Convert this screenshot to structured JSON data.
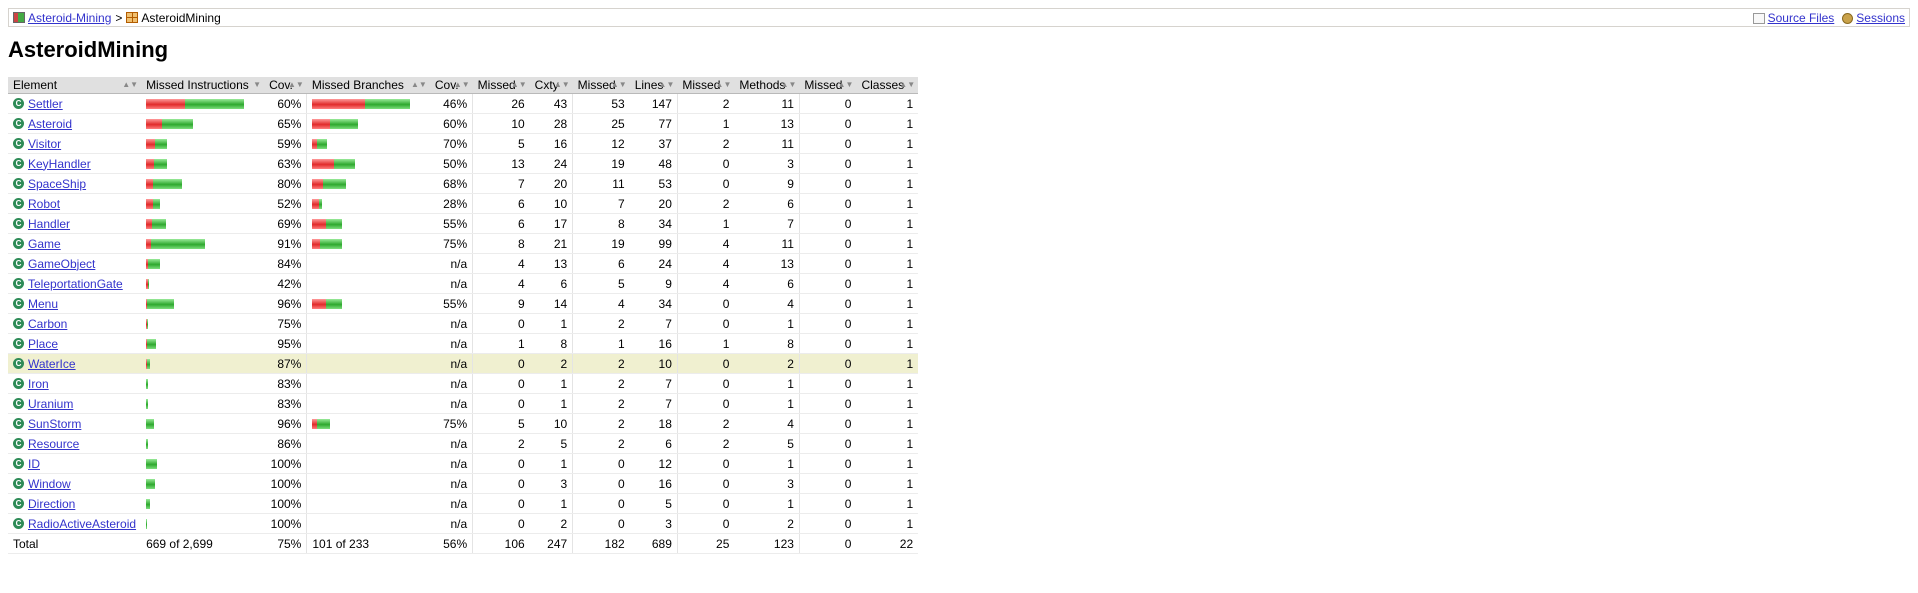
{
  "breadcrumb": {
    "report_link": "Asteroid-Mining",
    "separator": ">",
    "current": "AsteroidMining",
    "report_icon": "report-icon",
    "package_icon": "package-icon"
  },
  "info": {
    "source_files": "Source Files",
    "sessions": "Sessions",
    "source_icon": "source-file-icon",
    "sessions_icon": "sessions-icon"
  },
  "page_title": "AsteroidMining",
  "headers": {
    "element": "Element",
    "missed_instructions": "Missed Instructions",
    "cov1": "Cov.",
    "missed_branches": "Missed Branches",
    "cov2": "Cov.",
    "missed_cxty": "Missed",
    "cxty": "Cxty",
    "missed_lines": "Missed",
    "lines": "Lines",
    "missed_methods": "Missed",
    "methods": "Methods",
    "missed_classes": "Missed",
    "classes": "Classes"
  },
  "class_icon_glyph": "C",
  "rows": [
    {
      "name": "Settler",
      "instr_missed_frac": 0.4,
      "instr_total_rel": 1.0,
      "instr_cov": "60%",
      "br_missed_frac": 0.54,
      "br_total_rel": 1.0,
      "br_cov": "46%",
      "mc": "26",
      "c": "43",
      "ml": "53",
      "l": "147",
      "mm": "2",
      "m": "11",
      "mcl": "0",
      "cl": "1"
    },
    {
      "name": "Asteroid",
      "instr_missed_frac": 0.35,
      "instr_total_rel": 0.48,
      "instr_cov": "65%",
      "br_missed_frac": 0.4,
      "br_total_rel": 0.47,
      "br_cov": "60%",
      "mc": "10",
      "c": "28",
      "ml": "25",
      "l": "77",
      "mm": "1",
      "m": "13",
      "mcl": "0",
      "cl": "1"
    },
    {
      "name": "Visitor",
      "instr_missed_frac": 0.41,
      "instr_total_rel": 0.21,
      "instr_cov": "59%",
      "br_missed_frac": 0.3,
      "br_total_rel": 0.15,
      "br_cov": "70%",
      "mc": "5",
      "c": "16",
      "ml": "12",
      "l": "37",
      "mm": "2",
      "m": "11",
      "mcl": "0",
      "cl": "1"
    },
    {
      "name": "KeyHandler",
      "instr_missed_frac": 0.37,
      "instr_total_rel": 0.21,
      "instr_cov": "63%",
      "br_missed_frac": 0.5,
      "br_total_rel": 0.44,
      "br_cov": "50%",
      "mc": "13",
      "c": "24",
      "ml": "19",
      "l": "48",
      "mm": "0",
      "m": "3",
      "mcl": "0",
      "cl": "1"
    },
    {
      "name": "SpaceShip",
      "instr_missed_frac": 0.2,
      "instr_total_rel": 0.37,
      "instr_cov": "80%",
      "br_missed_frac": 0.32,
      "br_total_rel": 0.35,
      "br_cov": "68%",
      "mc": "7",
      "c": "20",
      "ml": "11",
      "l": "53",
      "mm": "0",
      "m": "9",
      "mcl": "0",
      "cl": "1"
    },
    {
      "name": "Robot",
      "instr_missed_frac": 0.48,
      "instr_total_rel": 0.14,
      "instr_cov": "52%",
      "br_missed_frac": 0.72,
      "br_total_rel": 0.1,
      "br_cov": "28%",
      "mc": "6",
      "c": "10",
      "ml": "7",
      "l": "20",
      "mm": "2",
      "m": "6",
      "mcl": "0",
      "cl": "1"
    },
    {
      "name": "Handler",
      "instr_missed_frac": 0.31,
      "instr_total_rel": 0.2,
      "instr_cov": "69%",
      "br_missed_frac": 0.45,
      "br_total_rel": 0.31,
      "br_cov": "55%",
      "mc": "6",
      "c": "17",
      "ml": "8",
      "l": "34",
      "mm": "1",
      "m": "7",
      "mcl": "0",
      "cl": "1"
    },
    {
      "name": "Game",
      "instr_missed_frac": 0.09,
      "instr_total_rel": 0.6,
      "instr_cov": "91%",
      "br_missed_frac": 0.25,
      "br_total_rel": 0.31,
      "br_cov": "75%",
      "mc": "8",
      "c": "21",
      "ml": "19",
      "l": "99",
      "mm": "4",
      "m": "11",
      "mcl": "0",
      "cl": "1"
    },
    {
      "name": "GameObject",
      "instr_missed_frac": 0.16,
      "instr_total_rel": 0.14,
      "instr_cov": "84%",
      "br_missed_frac": 0,
      "br_total_rel": 0,
      "br_cov": "n/a",
      "mc": "4",
      "c": "13",
      "ml": "6",
      "l": "24",
      "mm": "4",
      "m": "13",
      "mcl": "0",
      "cl": "1"
    },
    {
      "name": "TeleportationGate",
      "instr_missed_frac": 0.58,
      "instr_total_rel": 0.03,
      "instr_cov": "42%",
      "br_missed_frac": 0,
      "br_total_rel": 0,
      "br_cov": "n/a",
      "mc": "4",
      "c": "6",
      "ml": "5",
      "l": "9",
      "mm": "4",
      "m": "6",
      "mcl": "0",
      "cl": "1"
    },
    {
      "name": "Menu",
      "instr_missed_frac": 0.04,
      "instr_total_rel": 0.29,
      "instr_cov": "96%",
      "br_missed_frac": 0.45,
      "br_total_rel": 0.31,
      "br_cov": "55%",
      "mc": "9",
      "c": "14",
      "ml": "4",
      "l": "34",
      "mm": "0",
      "m": "4",
      "mcl": "0",
      "cl": "1"
    },
    {
      "name": "Carbon",
      "instr_missed_frac": 0.25,
      "instr_total_rel": 0.02,
      "instr_cov": "75%",
      "br_missed_frac": 0,
      "br_total_rel": 0,
      "br_cov": "n/a",
      "mc": "0",
      "c": "1",
      "ml": "2",
      "l": "7",
      "mm": "0",
      "m": "1",
      "mcl": "0",
      "cl": "1"
    },
    {
      "name": "Place",
      "instr_missed_frac": 0.05,
      "instr_total_rel": 0.1,
      "instr_cov": "95%",
      "br_missed_frac": 0,
      "br_total_rel": 0,
      "br_cov": "n/a",
      "mc": "1",
      "c": "8",
      "ml": "1",
      "l": "16",
      "mm": "1",
      "m": "8",
      "mcl": "0",
      "cl": "1"
    },
    {
      "name": "WaterIce",
      "instr_missed_frac": 0.13,
      "instr_total_rel": 0.04,
      "instr_cov": "87%",
      "br_missed_frac": 0,
      "br_total_rel": 0,
      "br_cov": "n/a",
      "mc": "0",
      "c": "2",
      "ml": "2",
      "l": "10",
      "mm": "0",
      "m": "2",
      "mcl": "0",
      "cl": "1",
      "highlight": true
    },
    {
      "name": "Iron",
      "instr_missed_frac": 0.17,
      "instr_total_rel": 0.02,
      "instr_cov": "83%",
      "br_missed_frac": 0,
      "br_total_rel": 0,
      "br_cov": "n/a",
      "mc": "0",
      "c": "1",
      "ml": "2",
      "l": "7",
      "mm": "0",
      "m": "1",
      "mcl": "0",
      "cl": "1"
    },
    {
      "name": "Uranium",
      "instr_missed_frac": 0.17,
      "instr_total_rel": 0.02,
      "instr_cov": "83%",
      "br_missed_frac": 0,
      "br_total_rel": 0,
      "br_cov": "n/a",
      "mc": "0",
      "c": "1",
      "ml": "2",
      "l": "7",
      "mm": "0",
      "m": "1",
      "mcl": "0",
      "cl": "1"
    },
    {
      "name": "SunStorm",
      "instr_missed_frac": 0.04,
      "instr_total_rel": 0.08,
      "instr_cov": "96%",
      "br_missed_frac": 0.25,
      "br_total_rel": 0.18,
      "br_cov": "75%",
      "mc": "5",
      "c": "10",
      "ml": "2",
      "l": "18",
      "mm": "2",
      "m": "4",
      "mcl": "0",
      "cl": "1"
    },
    {
      "name": "Resource",
      "instr_missed_frac": 0.14,
      "instr_total_rel": 0.02,
      "instr_cov": "86%",
      "br_missed_frac": 0,
      "br_total_rel": 0,
      "br_cov": "n/a",
      "mc": "2",
      "c": "5",
      "ml": "2",
      "l": "6",
      "mm": "2",
      "m": "5",
      "mcl": "0",
      "cl": "1"
    },
    {
      "name": "ID",
      "instr_missed_frac": 0,
      "instr_total_rel": 0.11,
      "instr_cov": "100%",
      "br_missed_frac": 0,
      "br_total_rel": 0,
      "br_cov": "n/a",
      "mc": "0",
      "c": "1",
      "ml": "0",
      "l": "12",
      "mm": "0",
      "m": "1",
      "mcl": "0",
      "cl": "1"
    },
    {
      "name": "Window",
      "instr_missed_frac": 0,
      "instr_total_rel": 0.09,
      "instr_cov": "100%",
      "br_missed_frac": 0,
      "br_total_rel": 0,
      "br_cov": "n/a",
      "mc": "0",
      "c": "3",
      "ml": "0",
      "l": "16",
      "mm": "0",
      "m": "3",
      "mcl": "0",
      "cl": "1"
    },
    {
      "name": "Direction",
      "instr_missed_frac": 0,
      "instr_total_rel": 0.04,
      "instr_cov": "100%",
      "br_missed_frac": 0,
      "br_total_rel": 0,
      "br_cov": "n/a",
      "mc": "0",
      "c": "1",
      "ml": "0",
      "l": "5",
      "mm": "0",
      "m": "1",
      "mcl": "0",
      "cl": "1"
    },
    {
      "name": "RadioActiveAsteroid",
      "instr_missed_frac": 0,
      "instr_total_rel": 0.015,
      "instr_cov": "100%",
      "br_missed_frac": 0,
      "br_total_rel": 0,
      "br_cov": "n/a",
      "mc": "0",
      "c": "2",
      "ml": "0",
      "l": "3",
      "mm": "0",
      "m": "2",
      "mcl": "0",
      "cl": "1"
    }
  ],
  "totals": {
    "label": "Total",
    "instr": "669 of 2,699",
    "instr_cov": "75%",
    "br": "101 of 233",
    "br_cov": "56%",
    "mc": "106",
    "c": "247",
    "ml": "182",
    "l": "689",
    "mm": "25",
    "m": "123",
    "mcl": "0",
    "cl": "22"
  },
  "colors": {
    "missed": "#e02a2a",
    "covered": "#2ea82e",
    "highlight_row": "#f0f0d0",
    "header_bg": "#e0e0e0",
    "link": "#3333cc"
  },
  "sort_indicator_icon": "sort-arrows-icon"
}
